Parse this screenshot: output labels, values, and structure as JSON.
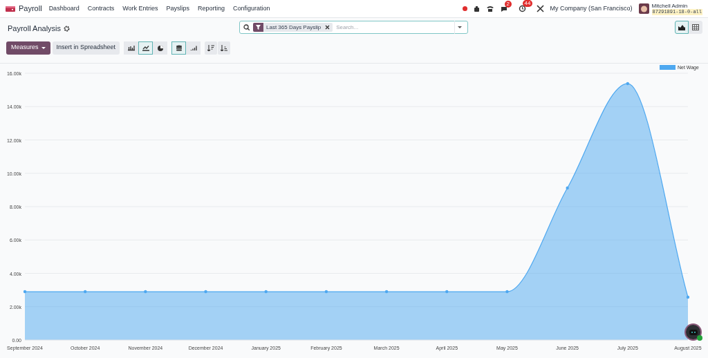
{
  "navbar": {
    "app_name": "Payroll",
    "menu": [
      "Dashboard",
      "Contracts",
      "Work Entries",
      "Payslips",
      "Reporting",
      "Configuration"
    ],
    "messages_badge": "2",
    "activities_badge": "44",
    "company": "My Company (San Francisco)",
    "user_name": "Mitchell Admin",
    "database": "87291891-18-0-all"
  },
  "control_panel": {
    "title": "Payroll Analysis",
    "search": {
      "facet": "Last 365 Days Payslip",
      "placeholder": "Search..."
    },
    "views": [
      {
        "kind": "graph",
        "selected": true
      },
      {
        "kind": "pivot",
        "selected": false
      }
    ],
    "measures_button": "Measures",
    "spreadsheet_button": "Insert in Spreadsheet",
    "chart_types": [
      {
        "kind": "bar",
        "selected": false
      },
      {
        "kind": "line",
        "selected": true
      },
      {
        "kind": "pie",
        "selected": false
      }
    ],
    "options": [
      {
        "kind": "stacked",
        "selected": true
      },
      {
        "kind": "cumulative",
        "selected": false
      }
    ]
  },
  "chart_data": {
    "type": "area",
    "categories": [
      "September 2024",
      "October 2024",
      "November 2024",
      "December 2024",
      "January 2025",
      "February 2025",
      "March 2025",
      "April 2025",
      "May 2025",
      "June 2025",
      "July 2025",
      "August 2025"
    ],
    "series": [
      {
        "name": "Net Wage",
        "color": "#4ea8f0",
        "values": [
          2900,
          2900,
          2900,
          2900,
          2900,
          2900,
          2900,
          2900,
          2900,
          9120,
          15380,
          2570
        ]
      }
    ],
    "ylim": [
      0,
      16000
    ],
    "grid": true,
    "yticks": [
      {
        "value": 0,
        "label": "0.00"
      },
      {
        "value": 2000,
        "label": "2.00k"
      },
      {
        "value": 4000,
        "label": "4.00k"
      },
      {
        "value": 6000,
        "label": "6.00k"
      },
      {
        "value": 8000,
        "label": "8.00k"
      },
      {
        "value": 10000,
        "label": "10.00k"
      },
      {
        "value": 12000,
        "label": "12.00k"
      },
      {
        "value": 14000,
        "label": "14.00k"
      },
      {
        "value": 16000,
        "label": "16.00k"
      }
    ]
  }
}
